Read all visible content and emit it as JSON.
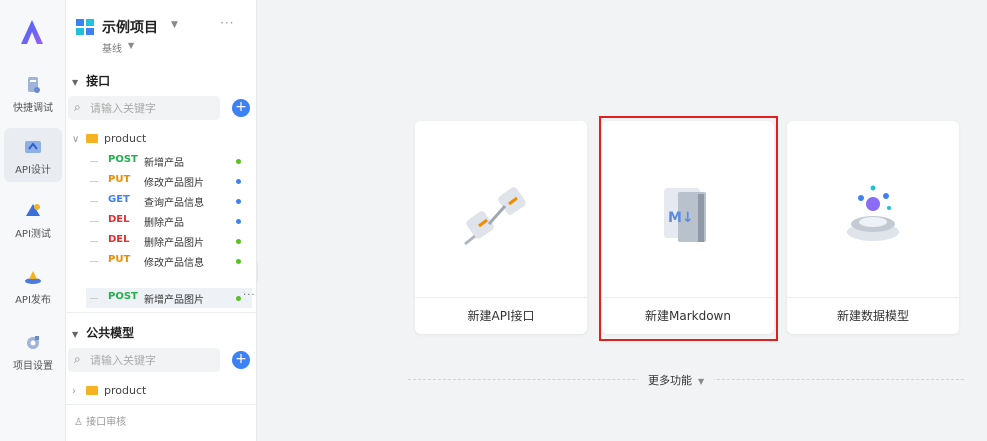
{
  "rail": {
    "items": [
      {
        "label": "快捷调试"
      },
      {
        "label": "API设计"
      },
      {
        "label": "API测试"
      },
      {
        "label": "API发布"
      },
      {
        "label": "项目设置"
      }
    ]
  },
  "project": {
    "name": "示例项目",
    "branch": "基线",
    "more": "···"
  },
  "api_section": {
    "title": "接口",
    "search_placeholder": "请输入关键字",
    "add": "+",
    "folder": "product",
    "items": [
      {
        "method": "POST",
        "name": "新增产品",
        "method_color": "#22b14c",
        "dot_color": "#52c41a"
      },
      {
        "method": "PUT",
        "name": "修改产品图片",
        "method_color": "#f08c00",
        "dot_color": "#3b82f6"
      },
      {
        "method": "GET",
        "name": "查询产品信息",
        "method_color": "#3b82f6",
        "dot_color": "#3b82f6"
      },
      {
        "method": "DEL",
        "name": "删除产品",
        "method_color": "#e03131",
        "dot_color": "#3b82f6"
      },
      {
        "method": "DEL",
        "name": "删除产品图片",
        "method_color": "#e03131",
        "dot_color": "#52c41a"
      },
      {
        "method": "PUT",
        "name": "修改产品信息",
        "method_color": "#f08c00",
        "dot_color": "#52c41a"
      },
      {
        "method": "POST",
        "name": "新增产品图片",
        "method_color": "#22b14c",
        "dot_color": "#52c41a",
        "more": "···"
      }
    ]
  },
  "model_section": {
    "title": "公共模型",
    "search_placeholder": "请输入关键字",
    "add": "+",
    "folder": "product"
  },
  "review": {
    "label": "接口审核"
  },
  "cards": [
    {
      "label": "新建API接口",
      "icon": "api-plug-icon"
    },
    {
      "label": "新建Markdown",
      "icon": "markdown-book-icon"
    },
    {
      "label": "新建数据模型",
      "icon": "data-model-icon"
    }
  ],
  "more_features": {
    "label": "更多功能"
  },
  "colors": {
    "accent": "#3b82f6",
    "highlight": "#e02020",
    "folder": "#f5b324"
  }
}
